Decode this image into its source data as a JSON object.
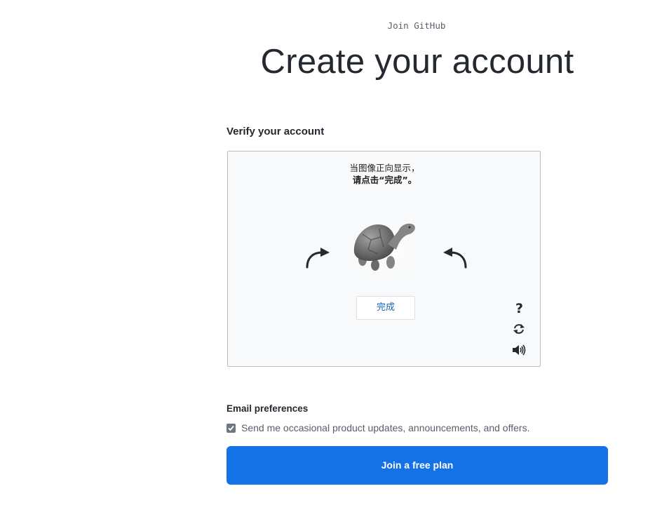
{
  "header": {
    "eyebrow": "Join GitHub",
    "title": "Create your account"
  },
  "verify": {
    "label": "Verify your account",
    "instruction_line1": "当图像正向显示，",
    "instruction_line2": "请点击“完成”。",
    "done_label": "完成",
    "image_subject": "turtle",
    "icons": {
      "rotate_left": "rotate-left-arrow-icon",
      "rotate_right": "rotate-right-arrow-icon",
      "help": "question-mark-icon",
      "refresh": "refresh-icon",
      "audio": "speaker-icon"
    }
  },
  "email": {
    "label": "Email preferences",
    "checkbox_label": "Send me occasional product updates, announcements, and offers.",
    "checked": true
  },
  "cta": {
    "label": "Join a free plan"
  },
  "colors": {
    "primary": "#1472e6",
    "link": "#1565c0",
    "text": "#24292f",
    "muted": "#57606a"
  }
}
